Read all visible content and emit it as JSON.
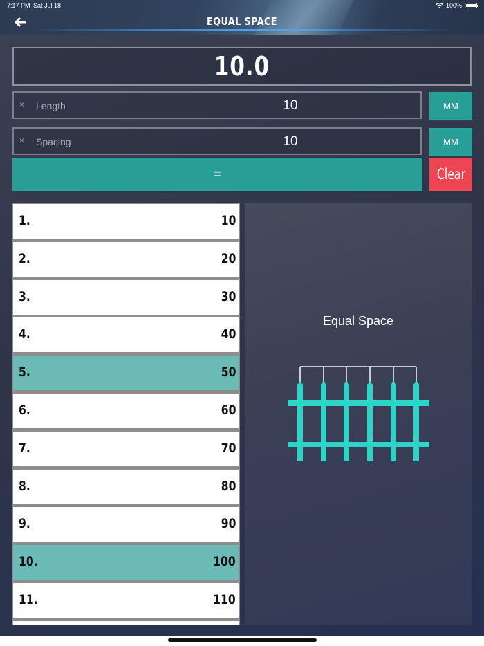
{
  "status": {
    "time": "7:17 PM",
    "date": "Sat Jul 18",
    "wifi_icon": "wifi-icon",
    "battery_text": "100%"
  },
  "nav": {
    "back_icon": "back-arrow-icon",
    "title": "EQUAL SPACE"
  },
  "result": {
    "value": "10.0"
  },
  "inputs": {
    "length": {
      "label": "Length",
      "value": "10",
      "unit": "MM"
    },
    "spacing": {
      "label": "Spacing",
      "value": "10",
      "unit": "MM"
    }
  },
  "actions": {
    "equals_label": "=",
    "clear_label": "Clear"
  },
  "list": [
    {
      "index": "1.",
      "value": "10",
      "highlight": false
    },
    {
      "index": "2.",
      "value": "20",
      "highlight": false
    },
    {
      "index": "3.",
      "value": "30",
      "highlight": false
    },
    {
      "index": "4.",
      "value": "40",
      "highlight": false
    },
    {
      "index": "5.",
      "value": "50",
      "highlight": true
    },
    {
      "index": "6.",
      "value": "60",
      "highlight": false
    },
    {
      "index": "7.",
      "value": "70",
      "highlight": false
    },
    {
      "index": "8.",
      "value": "80",
      "highlight": false
    },
    {
      "index": "9.",
      "value": "90",
      "highlight": false
    },
    {
      "index": "10.",
      "value": "100",
      "highlight": true
    },
    {
      "index": "11.",
      "value": "110",
      "highlight": false
    }
  ],
  "info": {
    "title": "Equal Space",
    "illustration": "fence-icon"
  },
  "colors": {
    "accent": "#279f97",
    "clear": "#ee4552",
    "highlight_row": "#6bbab6",
    "fence": "#2fd4c9"
  }
}
